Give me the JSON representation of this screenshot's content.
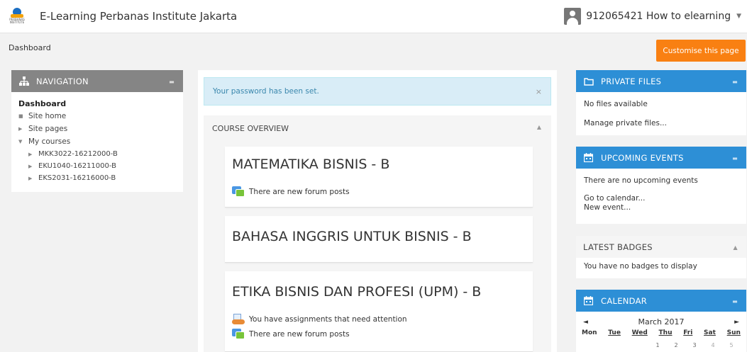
{
  "header": {
    "logo_text": "PERBANAS INSTITUTE",
    "site_name": "E-Learning Perbanas Institute Jakarta",
    "user_name": "912065421 How to elearning"
  },
  "breadcrumb": "Dashboard",
  "customise_button": "Customise this page",
  "navigation": {
    "title": "NAVIGATION",
    "dashboard": "Dashboard",
    "items": [
      {
        "label": "Site home"
      },
      {
        "label": "Site pages"
      },
      {
        "label": "My courses"
      }
    ],
    "courses": [
      {
        "label": "MKK3022-16212000-B"
      },
      {
        "label": "EKU1040-16211000-B"
      },
      {
        "label": "EKS2031-16216000-B"
      }
    ]
  },
  "main": {
    "alert": "Your password has been set.",
    "alert_close": "×",
    "course_overview_title": "COURSE OVERVIEW",
    "courses": [
      {
        "title": "MATEMATIKA BISNIS - B",
        "notes": [
          "There are new forum posts"
        ]
      },
      {
        "title": "BAHASA INGGRIS UNTUK BISNIS - B",
        "notes": []
      },
      {
        "title": "ETIKA BISNIS DAN PROFESI (UPM) - B",
        "notes": [
          "You have assignments that need attention",
          "There are new forum posts"
        ]
      }
    ]
  },
  "private_files": {
    "title": "PRIVATE FILES",
    "empty": "No files available",
    "manage_link": "Manage private files..."
  },
  "upcoming_events": {
    "title": "UPCOMING EVENTS",
    "empty": "There are no upcoming events",
    "calendar_link": "Go to calendar...",
    "new_event_link": "New event..."
  },
  "latest_badges": {
    "title": "LATEST BADGES",
    "empty": "You have no badges to display"
  },
  "calendar": {
    "title": "CALENDAR",
    "month": "March 2017",
    "prev": "◄",
    "next": "►",
    "days": [
      "Mon",
      "Tue",
      "Wed",
      "Thu",
      "Fri",
      "Sat",
      "Sun"
    ],
    "first_row": [
      "1",
      "2",
      "3",
      "4",
      "5"
    ]
  },
  "colors": {
    "accent": "#f98012",
    "block_header_blue": "#2d8fd6",
    "nav_header_gray": "#858585",
    "alert_bg": "#d9edf7"
  }
}
